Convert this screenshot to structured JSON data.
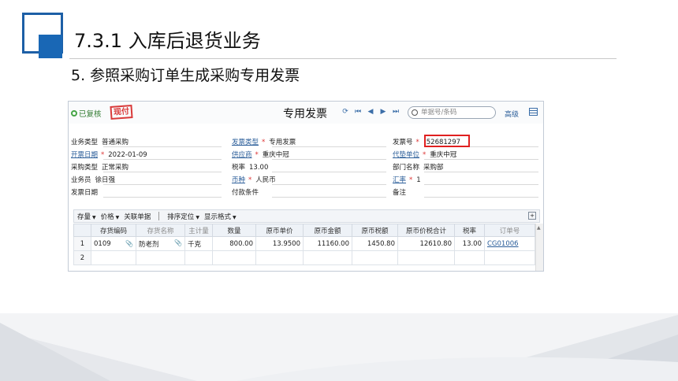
{
  "slide": {
    "title": "7.3.1  入库后退货业务",
    "subtitle": "5. 参照采购订单生成采购专用发票"
  },
  "window": {
    "status_text": "已复核",
    "stamp_text": "现付",
    "doc_title": "专用发票",
    "search_placeholder": "单据号/条码",
    "advanced_label": "高级",
    "nav_icons": [
      "refresh-icon",
      "first-icon",
      "prev-icon",
      "next-icon",
      "last-icon"
    ]
  },
  "form": {
    "business_type": {
      "label": "业务类型",
      "value": "普通采购"
    },
    "invoice_type": {
      "label": "发票类型",
      "value": "专用发票"
    },
    "invoice_no": {
      "label": "发票号",
      "value": "52681297"
    },
    "invoice_date": {
      "label": "开票日期",
      "value": "2022-01-09"
    },
    "supplier": {
      "label": "供应商",
      "value": "重庆中冠"
    },
    "payee": {
      "label": "代垫单位",
      "value": "重庆中冠"
    },
    "purchase_type": {
      "label": "采购类型",
      "value": "正常采购"
    },
    "tax_rate": {
      "label": "税率",
      "value": "13.00"
    },
    "department": {
      "label": "部门名称",
      "value": "采购部"
    },
    "salesperson": {
      "label": "业务员",
      "value": "徐日强"
    },
    "currency": {
      "label": "币种",
      "value": "人民币"
    },
    "exchange_rate": {
      "label": "汇率",
      "value": "1"
    },
    "due_date": {
      "label": "发票日期",
      "value": ""
    },
    "payment_terms": {
      "label": "付款条件",
      "value": ""
    },
    "remark": {
      "label": "备注",
      "value": ""
    },
    "required_mark": "*"
  },
  "table_toolbar": {
    "items": [
      "存量",
      "价格",
      "关联单据",
      "排序定位",
      "显示格式"
    ]
  },
  "table": {
    "columns": [
      "",
      "存货编码",
      "存货名称",
      "主计量",
      "数量",
      "原币单价",
      "原币金额",
      "原币税额",
      "原币价税合计",
      "税率",
      "订单号"
    ],
    "rows": [
      {
        "no": "1",
        "code": "0109",
        "name": "防老剂",
        "unit": "千克",
        "qty": "800.00",
        "price": "13.9500",
        "amount": "11160.00",
        "tax": "1450.80",
        "total": "12610.80",
        "rate": "13.00",
        "order": "CG01006"
      },
      {
        "no": "2",
        "code": "",
        "name": "",
        "unit": "",
        "qty": "",
        "price": "",
        "amount": "",
        "tax": "",
        "total": "",
        "rate": "",
        "order": ""
      }
    ]
  },
  "colors": {
    "accent": "#1967b5",
    "highlight": "#e02020",
    "link": "#2a5d99"
  }
}
